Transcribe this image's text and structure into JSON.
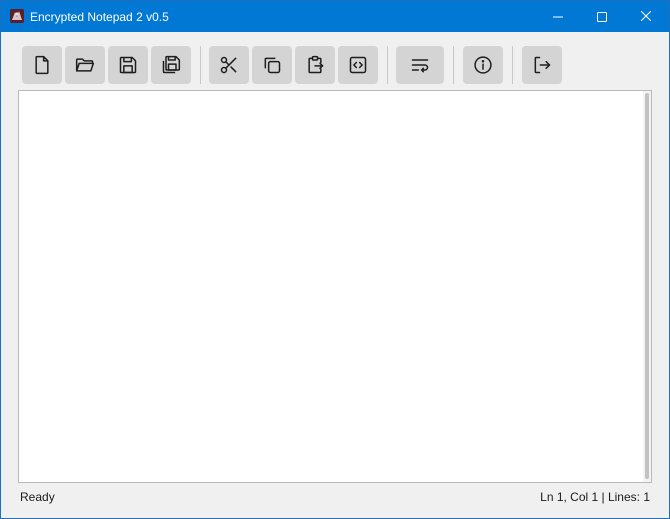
{
  "window": {
    "title": "Encrypted Notepad 2 v0.5"
  },
  "colors": {
    "titlebar": "#0078d4",
    "toolbar_button": "#d4d4d4",
    "background": "#f0f0f0",
    "editor": "#ffffff"
  },
  "toolbar": {
    "buttons": [
      {
        "id": "new",
        "icon": "new-file-icon"
      },
      {
        "id": "open",
        "icon": "folder-open-icon"
      },
      {
        "id": "save",
        "icon": "save-icon"
      },
      {
        "id": "save-as",
        "icon": "save-as-icon"
      },
      {
        "id": "cut",
        "icon": "scissors-icon"
      },
      {
        "id": "copy",
        "icon": "copy-icon"
      },
      {
        "id": "paste",
        "icon": "paste-icon"
      },
      {
        "id": "code",
        "icon": "code-icon"
      },
      {
        "id": "word-wrap",
        "icon": "word-wrap-icon"
      },
      {
        "id": "about",
        "icon": "info-icon"
      },
      {
        "id": "exit",
        "icon": "exit-icon"
      }
    ]
  },
  "editor": {
    "value": ""
  },
  "status": {
    "left": "Ready",
    "right": "Ln 1, Col 1 | Lines: 1"
  }
}
